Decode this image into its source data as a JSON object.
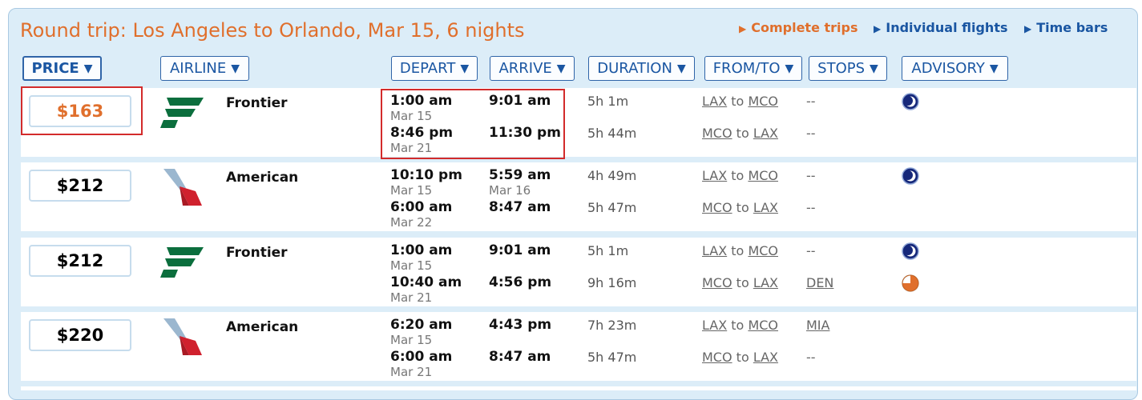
{
  "title": "Round trip: Los Angeles to Orlando, Mar 15, 6 nights",
  "view_links": [
    {
      "label": "Complete trips",
      "color": "#e06f2c"
    },
    {
      "label": "Individual flights",
      "color": "#1a56a2"
    },
    {
      "label": "Time bars",
      "color": "#1a56a2"
    }
  ],
  "columns": {
    "price": "PRICE",
    "airline": "AIRLINE",
    "depart": "DEPART",
    "arrive": "ARRIVE",
    "duration": "DURATION",
    "from_to": "FROM/TO",
    "stops": "STOPS",
    "advisory": "ADVISORY",
    "caret": "▼"
  },
  "to_word": "to",
  "advisory_icons": {
    "night": "moon-icon",
    "sunset": "sunset-icon"
  },
  "colors": {
    "accent": "#e06f2c",
    "link": "#1a56a2",
    "highlight": "#d32b2b"
  },
  "results": [
    {
      "price": "$163",
      "airline": "Frontier",
      "legs": [
        {
          "depart_time": "1:00 am",
          "depart_date": "Mar 15",
          "arrive_time": "9:01 am",
          "arrive_date": "",
          "duration": "5h 1m",
          "from": "LAX",
          "to": "MCO",
          "stops": "--",
          "advisory": "night"
        },
        {
          "depart_time": "8:46 pm",
          "depart_date": "Mar 21",
          "arrive_time": "11:30 pm",
          "arrive_date": "",
          "duration": "5h 44m",
          "from": "MCO",
          "to": "LAX",
          "stops": "--",
          "advisory": ""
        }
      ]
    },
    {
      "price": "$212",
      "airline": "American",
      "legs": [
        {
          "depart_time": "10:10 pm",
          "depart_date": "Mar 15",
          "arrive_time": "5:59 am",
          "arrive_date": "Mar 16",
          "duration": "4h 49m",
          "from": "LAX",
          "to": "MCO",
          "stops": "--",
          "advisory": "night"
        },
        {
          "depart_time": "6:00 am",
          "depart_date": "Mar 22",
          "arrive_time": "8:47 am",
          "arrive_date": "",
          "duration": "5h 47m",
          "from": "MCO",
          "to": "LAX",
          "stops": "--",
          "advisory": ""
        }
      ]
    },
    {
      "price": "$212",
      "airline": "Frontier",
      "legs": [
        {
          "depart_time": "1:00 am",
          "depart_date": "Mar 15",
          "arrive_time": "9:01 am",
          "arrive_date": "",
          "duration": "5h 1m",
          "from": "LAX",
          "to": "MCO",
          "stops": "--",
          "advisory": "night"
        },
        {
          "depart_time": "10:40 am",
          "depart_date": "Mar 21",
          "arrive_time": "4:56 pm",
          "arrive_date": "",
          "duration": "9h 16m",
          "from": "MCO",
          "to": "LAX",
          "stops": "DEN",
          "advisory": "sunset"
        }
      ]
    },
    {
      "price": "$220",
      "airline": "American",
      "legs": [
        {
          "depart_time": "6:20 am",
          "depart_date": "Mar 15",
          "arrive_time": "4:43 pm",
          "arrive_date": "",
          "duration": "7h 23m",
          "from": "LAX",
          "to": "MCO",
          "stops": "MIA",
          "advisory": ""
        },
        {
          "depart_time": "6:00 am",
          "depart_date": "Mar 21",
          "arrive_time": "8:47 am",
          "arrive_date": "",
          "duration": "5h 47m",
          "from": "MCO",
          "to": "LAX",
          "stops": "--",
          "advisory": ""
        }
      ]
    }
  ]
}
